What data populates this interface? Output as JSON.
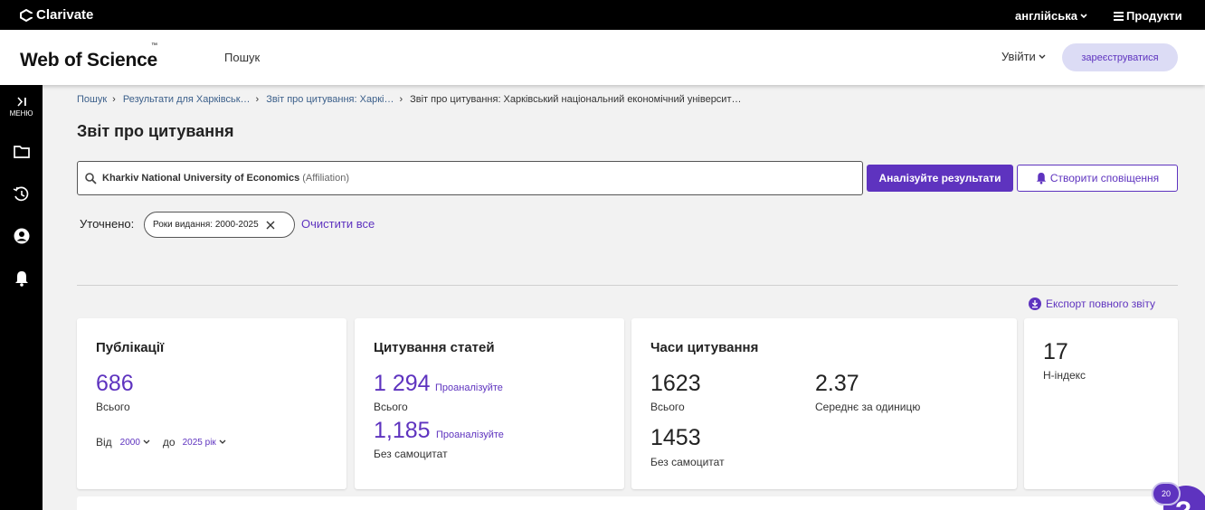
{
  "topbar": {
    "brand": "Clarivate",
    "language": "англійська",
    "products": "Продукти"
  },
  "header": {
    "logo": "Web of Science",
    "trademark": "™",
    "nav_search": "Пошук",
    "login": "Увійти",
    "register": "зареєструватися"
  },
  "sidebar": {
    "menu_label": "МЕНЮ",
    "items": [
      "menu-icon",
      "folder-icon",
      "history-icon",
      "account-icon",
      "bell-icon"
    ]
  },
  "breadcrumb": {
    "items": [
      {
        "label": "Пошук"
      },
      {
        "label": "Результати для Харківськ…"
      },
      {
        "label": "Звіт про цитування: Харкі…"
      },
      {
        "label": "Звіт про цитування: Харківський національний економічний університ…"
      }
    ]
  },
  "page": {
    "title": "Звіт про цитування"
  },
  "query": {
    "text": "Kharkiv National University of Economics",
    "field": "(Affiliation)"
  },
  "buttons": {
    "analyze": "Аналізуйте результати",
    "alert": "Створити сповіщення"
  },
  "refine": {
    "label": "Уточнено:",
    "chip": "Роки видання: 2000-2025",
    "clear": "Очистити все"
  },
  "export": {
    "label": "Експорт повного звіту"
  },
  "cards": {
    "publications": {
      "title": "Публікації",
      "total": "686",
      "total_label": "Всього",
      "from_label": "Від",
      "from_value": "2000",
      "to_label": "до",
      "to_value": "2025 рік"
    },
    "citing": {
      "title": "Цитування статей",
      "total": "1 294",
      "total_label": "Всього",
      "analyze1": "Проаналізуйте",
      "no_self": "1,185",
      "no_self_label": "Без самоцитат",
      "analyze2": "Проаналізуйте"
    },
    "times_cited": {
      "title": "Часи цитування",
      "total": "1623",
      "total_label": "Всього",
      "avg": "2.37",
      "avg_label": "Середнє за одиницю",
      "no_self": "1453",
      "no_self_label": "Без самоцитат"
    },
    "hindex": {
      "value": "17",
      "label": "Н-індекс"
    }
  },
  "help": {
    "badge": "20",
    "symbol": "?"
  },
  "colors": {
    "accent": "#5e33bf",
    "breadcrumb_link": "#3b5f8a"
  }
}
